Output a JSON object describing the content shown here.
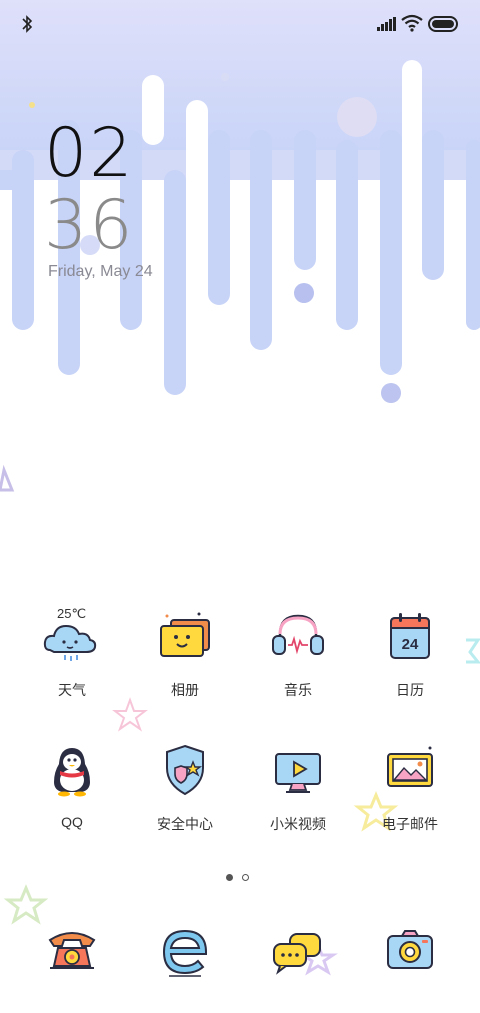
{
  "status_bar": {
    "bluetooth_icon": "bluetooth-icon",
    "signal_icon": "signal-icon",
    "wifi_icon": "wifi-icon",
    "battery_icon": "battery-icon"
  },
  "clock": {
    "hour": "02",
    "minute": "36",
    "date": "Friday, May 24"
  },
  "apps_row1": [
    {
      "label": "天气",
      "icon": "weather-icon",
      "temp": "25℃"
    },
    {
      "label": "相册",
      "icon": "gallery-icon"
    },
    {
      "label": "音乐",
      "icon": "music-icon"
    },
    {
      "label": "日历",
      "icon": "calendar-icon",
      "day": "24"
    }
  ],
  "apps_row2": [
    {
      "label": "QQ",
      "icon": "qq-penguin-icon"
    },
    {
      "label": "安全中心",
      "icon": "security-shield-icon"
    },
    {
      "label": "小米视频",
      "icon": "video-icon"
    },
    {
      "label": "电子邮件",
      "icon": "email-icon"
    }
  ],
  "dock": [
    {
      "icon": "phone-icon"
    },
    {
      "icon": "browser-icon"
    },
    {
      "icon": "messages-icon"
    },
    {
      "icon": "camera-icon"
    }
  ],
  "page_indicator": {
    "pages": 2,
    "current": 1
  },
  "colors": {
    "accent": "#c8d4f8",
    "drip": "#c3cff6",
    "text": "#333333"
  }
}
